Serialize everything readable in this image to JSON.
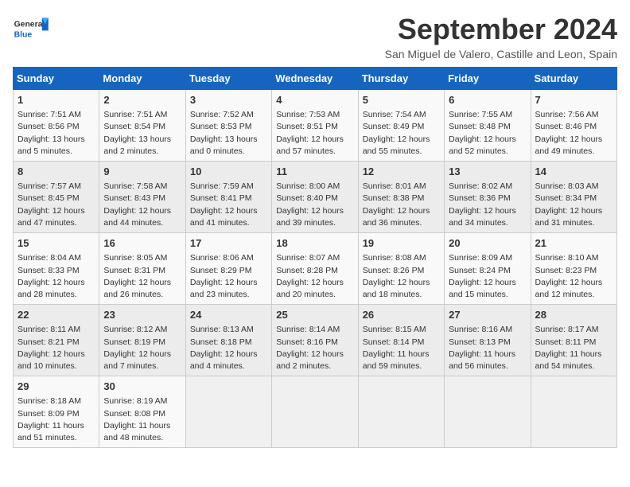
{
  "header": {
    "logo_general": "General",
    "logo_blue": "Blue",
    "month_title": "September 2024",
    "subtitle": "San Miguel de Valero, Castille and Leon, Spain"
  },
  "columns": [
    "Sunday",
    "Monday",
    "Tuesday",
    "Wednesday",
    "Thursday",
    "Friday",
    "Saturday"
  ],
  "weeks": [
    [
      {
        "day": "1",
        "line1": "Sunrise: 7:51 AM",
        "line2": "Sunset: 8:56 PM",
        "line3": "Daylight: 13 hours",
        "line4": "and 5 minutes."
      },
      {
        "day": "2",
        "line1": "Sunrise: 7:51 AM",
        "line2": "Sunset: 8:54 PM",
        "line3": "Daylight: 13 hours",
        "line4": "and 2 minutes."
      },
      {
        "day": "3",
        "line1": "Sunrise: 7:52 AM",
        "line2": "Sunset: 8:53 PM",
        "line3": "Daylight: 13 hours",
        "line4": "and 0 minutes."
      },
      {
        "day": "4",
        "line1": "Sunrise: 7:53 AM",
        "line2": "Sunset: 8:51 PM",
        "line3": "Daylight: 12 hours",
        "line4": "and 57 minutes."
      },
      {
        "day": "5",
        "line1": "Sunrise: 7:54 AM",
        "line2": "Sunset: 8:49 PM",
        "line3": "Daylight: 12 hours",
        "line4": "and 55 minutes."
      },
      {
        "day": "6",
        "line1": "Sunrise: 7:55 AM",
        "line2": "Sunset: 8:48 PM",
        "line3": "Daylight: 12 hours",
        "line4": "and 52 minutes."
      },
      {
        "day": "7",
        "line1": "Sunrise: 7:56 AM",
        "line2": "Sunset: 8:46 PM",
        "line3": "Daylight: 12 hours",
        "line4": "and 49 minutes."
      }
    ],
    [
      {
        "day": "8",
        "line1": "Sunrise: 7:57 AM",
        "line2": "Sunset: 8:45 PM",
        "line3": "Daylight: 12 hours",
        "line4": "and 47 minutes."
      },
      {
        "day": "9",
        "line1": "Sunrise: 7:58 AM",
        "line2": "Sunset: 8:43 PM",
        "line3": "Daylight: 12 hours",
        "line4": "and 44 minutes."
      },
      {
        "day": "10",
        "line1": "Sunrise: 7:59 AM",
        "line2": "Sunset: 8:41 PM",
        "line3": "Daylight: 12 hours",
        "line4": "and 41 minutes."
      },
      {
        "day": "11",
        "line1": "Sunrise: 8:00 AM",
        "line2": "Sunset: 8:40 PM",
        "line3": "Daylight: 12 hours",
        "line4": "and 39 minutes."
      },
      {
        "day": "12",
        "line1": "Sunrise: 8:01 AM",
        "line2": "Sunset: 8:38 PM",
        "line3": "Daylight: 12 hours",
        "line4": "and 36 minutes."
      },
      {
        "day": "13",
        "line1": "Sunrise: 8:02 AM",
        "line2": "Sunset: 8:36 PM",
        "line3": "Daylight: 12 hours",
        "line4": "and 34 minutes."
      },
      {
        "day": "14",
        "line1": "Sunrise: 8:03 AM",
        "line2": "Sunset: 8:34 PM",
        "line3": "Daylight: 12 hours",
        "line4": "and 31 minutes."
      }
    ],
    [
      {
        "day": "15",
        "line1": "Sunrise: 8:04 AM",
        "line2": "Sunset: 8:33 PM",
        "line3": "Daylight: 12 hours",
        "line4": "and 28 minutes."
      },
      {
        "day": "16",
        "line1": "Sunrise: 8:05 AM",
        "line2": "Sunset: 8:31 PM",
        "line3": "Daylight: 12 hours",
        "line4": "and 26 minutes."
      },
      {
        "day": "17",
        "line1": "Sunrise: 8:06 AM",
        "line2": "Sunset: 8:29 PM",
        "line3": "Daylight: 12 hours",
        "line4": "and 23 minutes."
      },
      {
        "day": "18",
        "line1": "Sunrise: 8:07 AM",
        "line2": "Sunset: 8:28 PM",
        "line3": "Daylight: 12 hours",
        "line4": "and 20 minutes."
      },
      {
        "day": "19",
        "line1": "Sunrise: 8:08 AM",
        "line2": "Sunset: 8:26 PM",
        "line3": "Daylight: 12 hours",
        "line4": "and 18 minutes."
      },
      {
        "day": "20",
        "line1": "Sunrise: 8:09 AM",
        "line2": "Sunset: 8:24 PM",
        "line3": "Daylight: 12 hours",
        "line4": "and 15 minutes."
      },
      {
        "day": "21",
        "line1": "Sunrise: 8:10 AM",
        "line2": "Sunset: 8:23 PM",
        "line3": "Daylight: 12 hours",
        "line4": "and 12 minutes."
      }
    ],
    [
      {
        "day": "22",
        "line1": "Sunrise: 8:11 AM",
        "line2": "Sunset: 8:21 PM",
        "line3": "Daylight: 12 hours",
        "line4": "and 10 minutes."
      },
      {
        "day": "23",
        "line1": "Sunrise: 8:12 AM",
        "line2": "Sunset: 8:19 PM",
        "line3": "Daylight: 12 hours",
        "line4": "and 7 minutes."
      },
      {
        "day": "24",
        "line1": "Sunrise: 8:13 AM",
        "line2": "Sunset: 8:18 PM",
        "line3": "Daylight: 12 hours",
        "line4": "and 4 minutes."
      },
      {
        "day": "25",
        "line1": "Sunrise: 8:14 AM",
        "line2": "Sunset: 8:16 PM",
        "line3": "Daylight: 12 hours",
        "line4": "and 2 minutes."
      },
      {
        "day": "26",
        "line1": "Sunrise: 8:15 AM",
        "line2": "Sunset: 8:14 PM",
        "line3": "Daylight: 11 hours",
        "line4": "and 59 minutes."
      },
      {
        "day": "27",
        "line1": "Sunrise: 8:16 AM",
        "line2": "Sunset: 8:13 PM",
        "line3": "Daylight: 11 hours",
        "line4": "and 56 minutes."
      },
      {
        "day": "28",
        "line1": "Sunrise: 8:17 AM",
        "line2": "Sunset: 8:11 PM",
        "line3": "Daylight: 11 hours",
        "line4": "and 54 minutes."
      }
    ],
    [
      {
        "day": "29",
        "line1": "Sunrise: 8:18 AM",
        "line2": "Sunset: 8:09 PM",
        "line3": "Daylight: 11 hours",
        "line4": "and 51 minutes."
      },
      {
        "day": "30",
        "line1": "Sunrise: 8:19 AM",
        "line2": "Sunset: 8:08 PM",
        "line3": "Daylight: 11 hours",
        "line4": "and 48 minutes."
      },
      {
        "day": "",
        "line1": "",
        "line2": "",
        "line3": "",
        "line4": ""
      },
      {
        "day": "",
        "line1": "",
        "line2": "",
        "line3": "",
        "line4": ""
      },
      {
        "day": "",
        "line1": "",
        "line2": "",
        "line3": "",
        "line4": ""
      },
      {
        "day": "",
        "line1": "",
        "line2": "",
        "line3": "",
        "line4": ""
      },
      {
        "day": "",
        "line1": "",
        "line2": "",
        "line3": "",
        "line4": ""
      }
    ]
  ]
}
